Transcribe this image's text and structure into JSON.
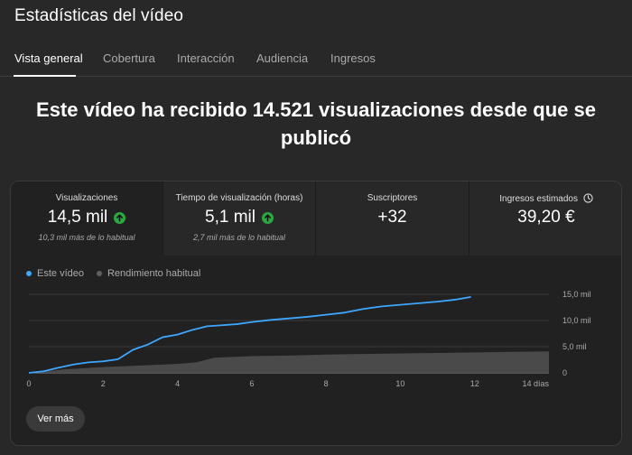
{
  "page": {
    "title": "Estadísticas del vídeo"
  },
  "tabs": [
    {
      "label": "Vista general",
      "active": true
    },
    {
      "label": "Cobertura",
      "active": false
    },
    {
      "label": "Interacción",
      "active": false
    },
    {
      "label": "Audiencia",
      "active": false
    },
    {
      "label": "Ingresos",
      "active": false
    }
  ],
  "headline": "Este vídeo ha recibido 14.521 visualizaciones desde que se publicó",
  "metrics": [
    {
      "label": "Visualizaciones",
      "value": "14,5 mil",
      "trend": "up",
      "sub": "10,3 mil más de lo habitual"
    },
    {
      "label": "Tiempo de visualización (horas)",
      "value": "5,1 mil",
      "trend": "up",
      "sub": "2,7 mil más de lo habitual"
    },
    {
      "label": "Suscriptores",
      "value": "+32",
      "trend": "",
      "sub": ""
    },
    {
      "label": "Ingresos estimados",
      "value": "39,20 €",
      "trend": "",
      "sub": "",
      "icon": "clock-icon"
    }
  ],
  "legend": [
    {
      "label": "Este vídeo",
      "color": "#3ea6ff"
    },
    {
      "label": "Rendimiento habitual",
      "color": "#606060"
    }
  ],
  "chart_data": {
    "type": "area",
    "x_ticks": [
      "0",
      "2",
      "4",
      "6",
      "8",
      "10",
      "12",
      "14 días"
    ],
    "y_ticks": [
      "0",
      "5,0 mil",
      "10,0 mil",
      "15,0 mil"
    ],
    "xlim": [
      0,
      14
    ],
    "ylim": [
      0,
      15000
    ],
    "series": [
      {
        "name": "Este vídeo",
        "color": "#3ea6ff",
        "x": [
          0,
          0.4,
          0.8,
          1.2,
          1.6,
          2.0,
          2.4,
          2.8,
          3.2,
          3.6,
          4.0,
          4.4,
          4.8,
          5.2,
          5.6,
          6.0,
          6.5,
          7.0,
          7.5,
          8.0,
          8.5,
          9.0,
          9.5,
          10.0,
          10.5,
          11.0,
          11.5,
          11.9
        ],
        "y": [
          0,
          300,
          1000,
          1600,
          2000,
          2200,
          2600,
          4400,
          5400,
          6800,
          7300,
          8200,
          8900,
          9100,
          9300,
          9700,
          10100,
          10400,
          10700,
          11100,
          11500,
          12200,
          12700,
          13000,
          13300,
          13600,
          14000,
          14500
        ]
      },
      {
        "name": "Rendimiento habitual",
        "color": "#4a4a4a",
        "x": [
          0,
          0.5,
          1.0,
          2.0,
          3.0,
          4.0,
          4.5,
          5.0,
          6.0,
          7.0,
          8.0,
          9.0,
          10.0,
          11.0,
          12.0,
          13.0,
          14.0
        ],
        "y": [
          0,
          300,
          700,
          1100,
          1400,
          1700,
          2000,
          2900,
          3200,
          3300,
          3500,
          3600,
          3700,
          3800,
          3900,
          4000,
          4100
        ]
      }
    ]
  },
  "actions": {
    "more_label": "Ver más"
  }
}
